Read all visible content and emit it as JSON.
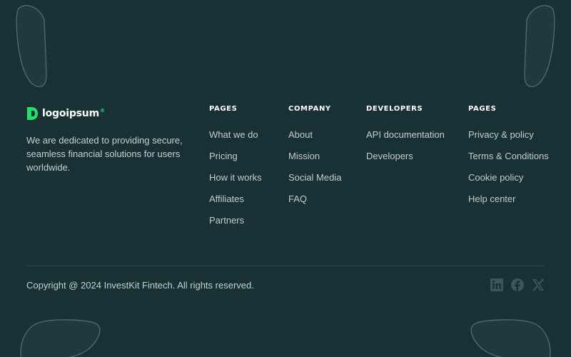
{
  "brand": {
    "logo_text": "logoipsum",
    "logo_mark": "®",
    "tagline": "We are dedicated to providing secure, seamless financial solutions for users worldwide."
  },
  "columns": [
    {
      "title": "PAGES",
      "links": [
        "What we do",
        "Pricing",
        "How it works",
        "Affiliates",
        "Partners"
      ]
    },
    {
      "title": "COMPANY",
      "links": [
        "About",
        "Mission",
        "Social Media",
        "FAQ"
      ]
    },
    {
      "title": "DEVELOPERS",
      "links": [
        "API documentation",
        "Developers"
      ]
    },
    {
      "title": "PAGES",
      "links": [
        "Privacy & policy",
        "Terms & Conditions",
        "Cookie policy",
        "Help center"
      ]
    }
  ],
  "footer": {
    "copyright": "Copyright @ 2024 InvestKit Fintech. All rights reserved.",
    "socials": [
      "linkedin-icon",
      "facebook-icon",
      "x-icon"
    ]
  },
  "colors": {
    "background": "#183134",
    "accent": "#22e06a",
    "heading": "#ffffff",
    "text": "#c7d1d1",
    "divider": "#2b4447",
    "social_icon": "#3c5659"
  }
}
